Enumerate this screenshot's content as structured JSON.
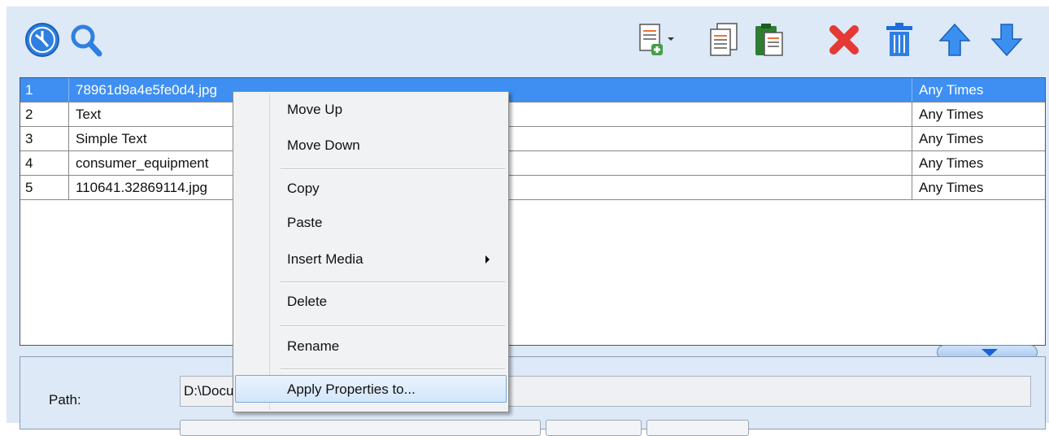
{
  "toolbar": {
    "left_icons": [
      "clock-icon",
      "search-icon"
    ],
    "right_icons": [
      "add-document-icon",
      "copy-document-icon",
      "paste-icon",
      "delete-x-icon",
      "trash-icon",
      "arrow-up-icon",
      "arrow-down-icon"
    ],
    "colors": {
      "blue": "#2f7fe0",
      "green": "#43a047",
      "red": "#e53935"
    }
  },
  "playlist": {
    "rows": [
      {
        "num": "1",
        "name": "78961d9a4e5fe0d4.jpg",
        "time": "Any Times",
        "selected": true
      },
      {
        "num": "2",
        "name": "Text",
        "time": "Any Times"
      },
      {
        "num": "3",
        "name": "Simple Text",
        "time": "Any Times"
      },
      {
        "num": "4",
        "name": "consumer_equipment",
        "time": "Any Times"
      },
      {
        "num": "5",
        "name": "110641.32869114.jpg",
        "time": "Any Times"
      }
    ],
    "selection_color": "#3e8ff1"
  },
  "properties": {
    "path_label": "Path:",
    "path_value": "D:\\Documents\\78961d9a4e5fe0d4.jpg"
  },
  "context_menu": {
    "items": [
      {
        "label": "Move Up"
      },
      {
        "label": "Move Down"
      },
      {
        "label": "Copy"
      },
      {
        "label": "Paste"
      },
      {
        "label": "Insert Media",
        "submenu": true
      },
      {
        "label": "Delete"
      },
      {
        "label": "Rename"
      },
      {
        "label": "Apply Properties to...",
        "highlighted": true
      }
    ]
  }
}
